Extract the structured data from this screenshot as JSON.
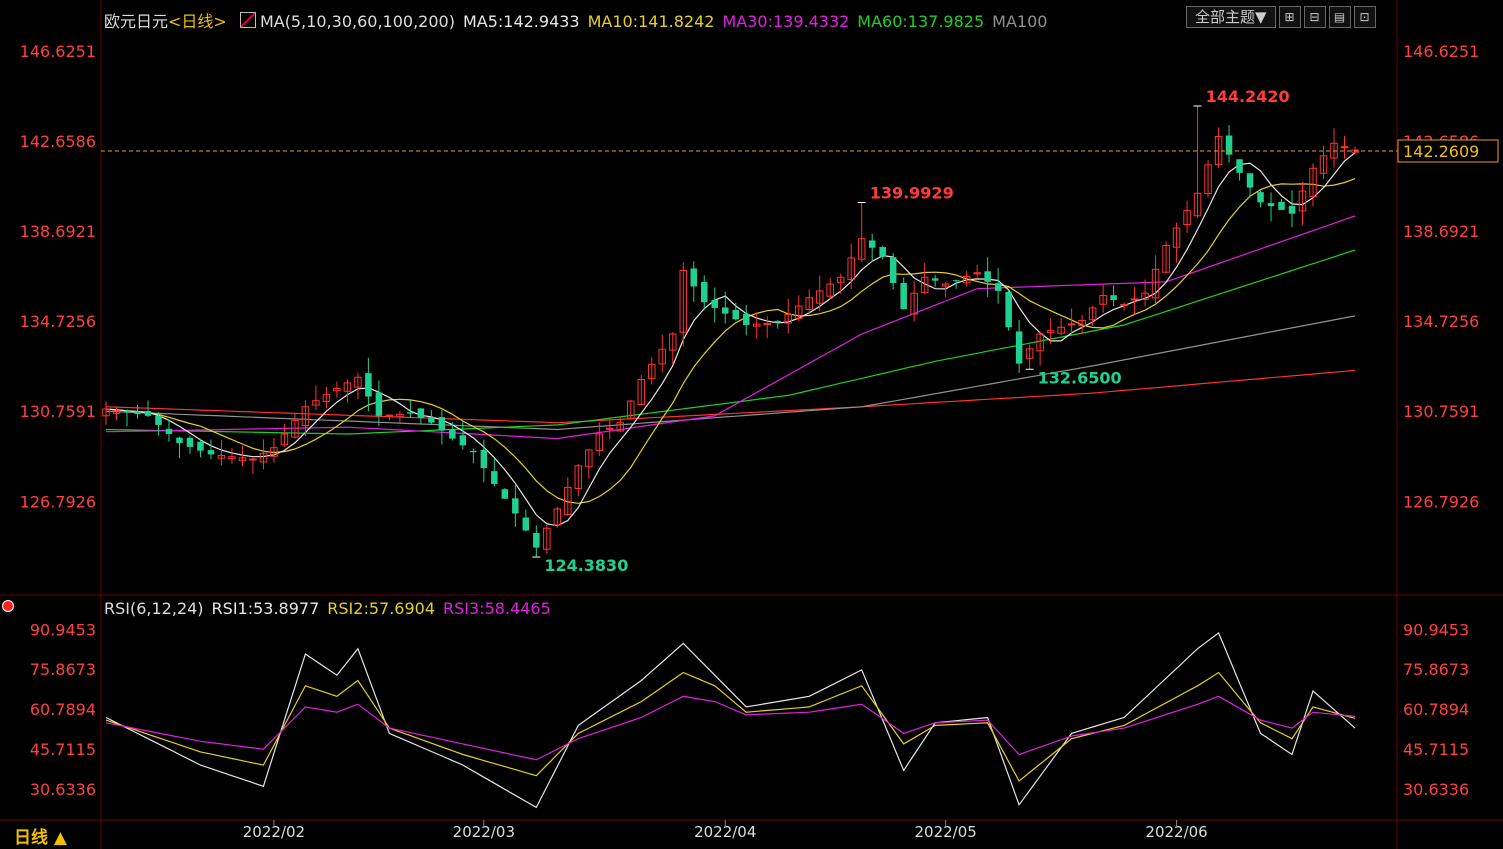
{
  "header": {
    "symbol": "欧元日元",
    "period": "<日线>",
    "ma_spec": "MA(5,10,30,60,100,200)",
    "ma_values": [
      {
        "text": "MA5:142.9433",
        "color": "#e6e6e6"
      },
      {
        "text": "MA10:141.8242",
        "color": "#e6d020"
      },
      {
        "text": "MA30:139.4332",
        "color": "#e020e0"
      },
      {
        "text": "MA60:137.9825",
        "color": "#20d020"
      },
      {
        "text": "MA100",
        "color": "#909090"
      }
    ]
  },
  "toolbar": {
    "theme_label": "全部主题▼",
    "icons": [
      "grid-icon",
      "layout-icon",
      "chart-icon",
      "expand-icon"
    ],
    "icon_glyphs": [
      "⊞",
      "⊟",
      "▤",
      "⊡"
    ]
  },
  "rsi_header": {
    "spec": "RSI(6,12,24)",
    "values": [
      {
        "text": "RSI1:53.8977",
        "color": "#e6e6e6"
      },
      {
        "text": "RSI2:57.6904",
        "color": "#e6d020"
      },
      {
        "text": "RSI3:58.4465",
        "color": "#e020e0"
      }
    ]
  },
  "period_tab": "日线 ▲",
  "colors": {
    "up": "#ff3232",
    "down": "#20d090",
    "grid": "#5a0000",
    "axis_text": "#ff4040",
    "ma5": "#e6e6e6",
    "ma10": "#e6d020",
    "ma30": "#e020e0",
    "ma60": "#20d020",
    "ma100": "#909090",
    "ma200": "#ff3030"
  },
  "chart_data": [
    {
      "type": "candlestick",
      "title": "欧元日元 日线",
      "x": [
        "2022/02",
        "2022/03",
        "2022/04",
        "2022/05",
        "2022/06"
      ],
      "y_ticks": [
        146.6251,
        142.6586,
        138.6921,
        134.7256,
        130.7591,
        126.7926
      ],
      "ylim": [
        122.8,
        147.5
      ],
      "current_price": 142.2609,
      "annotations": [
        {
          "label": "144.2420",
          "date": "2022-06-03",
          "price": 144.242
        },
        {
          "label": "139.9929",
          "date": "2022-04-20",
          "price": 139.9929
        },
        {
          "label": "132.6500",
          "date": "2022-05-12",
          "price": 132.65
        },
        {
          "label": "124.3830",
          "date": "2022-03-08",
          "price": 124.383
        }
      ],
      "close_waypoints": [
        [
          "2022-01-10",
          130.9
        ],
        [
          "2022-01-14",
          130.6
        ],
        [
          "2022-01-19",
          129.4
        ],
        [
          "2022-01-24",
          128.9
        ],
        [
          "2022-01-28",
          128.7
        ],
        [
          "2022-02-01",
          129.2
        ],
        [
          "2022-02-04",
          131.0
        ],
        [
          "2022-02-09",
          131.8
        ],
        [
          "2022-02-11",
          132.3
        ],
        [
          "2022-02-15",
          130.6
        ],
        [
          "2022-02-18",
          130.7
        ],
        [
          "2022-02-22",
          130.3
        ],
        [
          "2022-02-24",
          129.6
        ],
        [
          "2022-02-28",
          129.0
        ],
        [
          "2022-03-02",
          127.6
        ],
        [
          "2022-03-04",
          126.3
        ],
        [
          "2022-03-08",
          124.8
        ],
        [
          "2022-03-10",
          126.5
        ],
        [
          "2022-03-14",
          128.4
        ],
        [
          "2022-03-16",
          129.8
        ],
        [
          "2022-03-18",
          130.3
        ],
        [
          "2022-03-22",
          132.2
        ],
        [
          "2022-03-25",
          134.2
        ],
        [
          "2022-03-28",
          137.0
        ],
        [
          "2022-03-30",
          135.6
        ],
        [
          "2022-04-01",
          135.1
        ],
        [
          "2022-04-05",
          134.6
        ],
        [
          "2022-04-08",
          134.7
        ],
        [
          "2022-04-13",
          135.8
        ],
        [
          "2022-04-18",
          136.7
        ],
        [
          "2022-04-20",
          138.4
        ],
        [
          "2022-04-22",
          137.6
        ],
        [
          "2022-04-26",
          135.3
        ],
        [
          "2022-04-28",
          136.7
        ],
        [
          "2022-05-02",
          136.4
        ],
        [
          "2022-05-05",
          136.9
        ],
        [
          "2022-05-09",
          136.1
        ],
        [
          "2022-05-11",
          132.9
        ],
        [
          "2022-05-13",
          134.2
        ],
        [
          "2022-05-17",
          134.5
        ],
        [
          "2022-05-19",
          134.8
        ],
        [
          "2022-05-23",
          135.9
        ],
        [
          "2022-05-25",
          135.5
        ],
        [
          "2022-05-27",
          136.0
        ],
        [
          "2022-05-31",
          138.1
        ],
        [
          "2022-06-03",
          140.4
        ],
        [
          "2022-06-07",
          142.9
        ],
        [
          "2022-06-09",
          141.3
        ],
        [
          "2022-06-13",
          140.0
        ],
        [
          "2022-06-16",
          139.5
        ],
        [
          "2022-06-20",
          141.5
        ],
        [
          "2022-06-22",
          142.6
        ],
        [
          "2022-06-24",
          142.3
        ]
      ],
      "ma_waypoints": {
        "MA30": [
          [
            "2022-01-10",
            129.9
          ],
          [
            "2022-02-10",
            130.1
          ],
          [
            "2022-03-10",
            129.6
          ],
          [
            "2022-03-31",
            130.6
          ],
          [
            "2022-04-20",
            134.2
          ],
          [
            "2022-05-05",
            136.2
          ],
          [
            "2022-05-31",
            136.5
          ],
          [
            "2022-06-24",
            139.4
          ]
        ],
        "MA60": [
          [
            "2022-01-10",
            130.0
          ],
          [
            "2022-02-10",
            129.8
          ],
          [
            "2022-03-10",
            130.2
          ],
          [
            "2022-04-10",
            131.5
          ],
          [
            "2022-04-29",
            133.0
          ],
          [
            "2022-05-25",
            134.6
          ],
          [
            "2022-06-24",
            137.9
          ]
        ],
        "MA100": [
          [
            "2022-01-10",
            130.8
          ],
          [
            "2022-03-10",
            130.0
          ],
          [
            "2022-04-20",
            131.0
          ],
          [
            "2022-05-20",
            132.8
          ],
          [
            "2022-06-24",
            135.0
          ]
        ],
        "MA200": [
          [
            "2022-01-10",
            131.0
          ],
          [
            "2022-03-10",
            130.3
          ],
          [
            "2022-04-20",
            131.0
          ],
          [
            "2022-05-20",
            131.6
          ],
          [
            "2022-06-24",
            132.6
          ]
        ]
      }
    },
    {
      "type": "line",
      "title": "RSI(6,12,24)",
      "y_ticks": [
        90.9453,
        75.8673,
        60.7894,
        45.7115,
        30.6336
      ],
      "ylim": [
        20,
        96
      ],
      "series": [
        {
          "name": "RSI1",
          "color": "#e6e6e6",
          "waypoints": [
            [
              "2022-01-10",
              58
            ],
            [
              "2022-01-21",
              40
            ],
            [
              "2022-01-31",
              32
            ],
            [
              "2022-02-04",
              82
            ],
            [
              "2022-02-09",
              74
            ],
            [
              "2022-02-11",
              84
            ],
            [
              "2022-02-16",
              52
            ],
            [
              "2022-02-25",
              40
            ],
            [
              "2022-03-08",
              24
            ],
            [
              "2022-03-14",
              55
            ],
            [
              "2022-03-22",
              72
            ],
            [
              "2022-03-28",
              86
            ],
            [
              "2022-03-31",
              74
            ],
            [
              "2022-04-05",
              62
            ],
            [
              "2022-04-13",
              66
            ],
            [
              "2022-04-20",
              76
            ],
            [
              "2022-04-26",
              38
            ],
            [
              "2022-04-29",
              56
            ],
            [
              "2022-05-06",
              58
            ],
            [
              "2022-05-11",
              25
            ],
            [
              "2022-05-18",
              52
            ],
            [
              "2022-05-25",
              58
            ],
            [
              "2022-06-03",
              84
            ],
            [
              "2022-06-07",
              90
            ],
            [
              "2022-06-13",
              52
            ],
            [
              "2022-06-16",
              44
            ],
            [
              "2022-06-20",
              68
            ],
            [
              "2022-06-24",
              54
            ]
          ]
        },
        {
          "name": "RSI2",
          "color": "#e6d020",
          "waypoints": [
            [
              "2022-01-10",
              57
            ],
            [
              "2022-01-21",
              45
            ],
            [
              "2022-01-31",
              40
            ],
            [
              "2022-02-04",
              70
            ],
            [
              "2022-02-09",
              66
            ],
            [
              "2022-02-11",
              72
            ],
            [
              "2022-02-16",
              54
            ],
            [
              "2022-02-25",
              44
            ],
            [
              "2022-03-08",
              36
            ],
            [
              "2022-03-14",
              52
            ],
            [
              "2022-03-22",
              64
            ],
            [
              "2022-03-28",
              75
            ],
            [
              "2022-03-31",
              70
            ],
            [
              "2022-04-05",
              60
            ],
            [
              "2022-04-13",
              62
            ],
            [
              "2022-04-20",
              70
            ],
            [
              "2022-04-26",
              48
            ],
            [
              "2022-04-29",
              55
            ],
            [
              "2022-05-06",
              56
            ],
            [
              "2022-05-11",
              34
            ],
            [
              "2022-05-18",
              50
            ],
            [
              "2022-05-25",
              55
            ],
            [
              "2022-06-03",
              70
            ],
            [
              "2022-06-07",
              75
            ],
            [
              "2022-06-13",
              56
            ],
            [
              "2022-06-16",
              50
            ],
            [
              "2022-06-20",
              62
            ],
            [
              "2022-06-24",
              57.7
            ]
          ]
        },
        {
          "name": "RSI3",
          "color": "#e020e0",
          "waypoints": [
            [
              "2022-01-10",
              56
            ],
            [
              "2022-01-21",
              49
            ],
            [
              "2022-01-31",
              46
            ],
            [
              "2022-02-04",
              62
            ],
            [
              "2022-02-09",
              60
            ],
            [
              "2022-02-11",
              63
            ],
            [
              "2022-02-16",
              54
            ],
            [
              "2022-02-25",
              48
            ],
            [
              "2022-03-08",
              42
            ],
            [
              "2022-03-14",
              50
            ],
            [
              "2022-03-22",
              58
            ],
            [
              "2022-03-28",
              66
            ],
            [
              "2022-03-31",
              64
            ],
            [
              "2022-04-05",
              59
            ],
            [
              "2022-04-13",
              60
            ],
            [
              "2022-04-20",
              63
            ],
            [
              "2022-04-26",
              52
            ],
            [
              "2022-04-29",
              56
            ],
            [
              "2022-05-06",
              57
            ],
            [
              "2022-05-11",
              44
            ],
            [
              "2022-05-18",
              51
            ],
            [
              "2022-05-25",
              54
            ],
            [
              "2022-06-03",
              63
            ],
            [
              "2022-06-07",
              66
            ],
            [
              "2022-06-13",
              57
            ],
            [
              "2022-06-16",
              54
            ],
            [
              "2022-06-20",
              60
            ],
            [
              "2022-06-24",
              58.4
            ]
          ]
        }
      ]
    }
  ]
}
